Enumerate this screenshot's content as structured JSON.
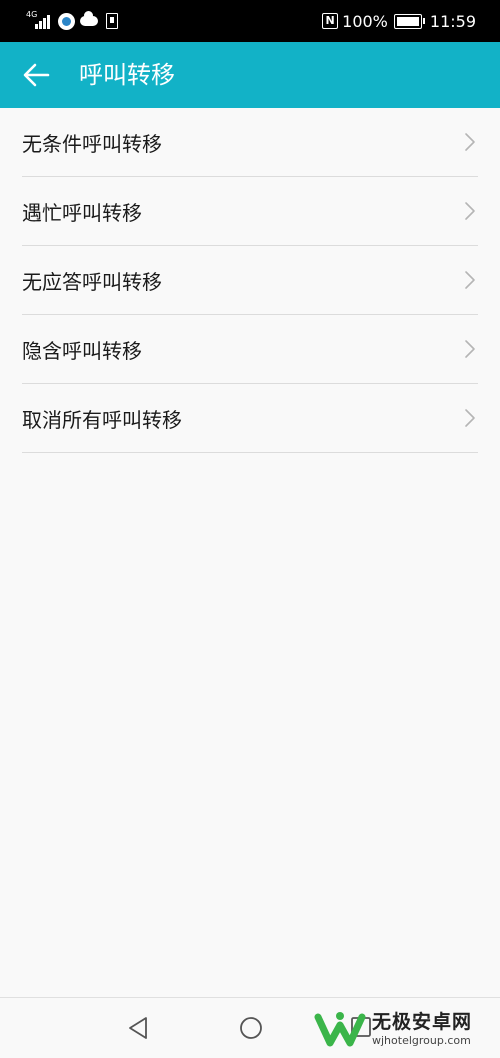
{
  "status_bar": {
    "network_type": "4G",
    "battery_percent": "100%",
    "time": "11:59",
    "icons": [
      "signal-icon",
      "app-notification-icon",
      "cloud-icon",
      "sim-icon",
      "nfc-icon",
      "battery-icon"
    ]
  },
  "app_bar": {
    "title": "呼叫转移",
    "background_color": "#12b2c7",
    "back_icon": "arrow-left-icon"
  },
  "list": {
    "items": [
      {
        "label": "无条件呼叫转移"
      },
      {
        "label": "遇忙呼叫转移"
      },
      {
        "label": "无应答呼叫转移"
      },
      {
        "label": "隐含呼叫转移"
      },
      {
        "label": "取消所有呼叫转移"
      }
    ]
  },
  "nav_bar": {
    "icons": [
      "nav-back-icon",
      "nav-home-icon",
      "nav-recent-icon"
    ]
  },
  "watermark": {
    "title": "无极安卓网",
    "url": "wjhotelgroup.com"
  }
}
